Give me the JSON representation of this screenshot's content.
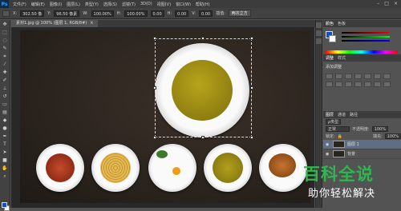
{
  "app": {
    "logo": "Ps"
  },
  "menu": [
    "文件(F)",
    "编辑(E)",
    "图像(I)",
    "图层(L)",
    "类型(Y)",
    "选择(S)",
    "滤镜(T)",
    "3D(D)",
    "视图(V)",
    "窗口(W)",
    "帮助(H)"
  ],
  "options": {
    "x_label": "X:",
    "x_value": "302.50 像",
    "y_label": "Y:",
    "y_value": "96.50 像素",
    "w_label": "W:",
    "w_value": "100.00%",
    "h_label": "H:",
    "h_value": "100.00%",
    "angle_value": "0.00",
    "h2_label": "H:",
    "h2_value": "0.00",
    "v_label": "V:",
    "v_value": "0.00",
    "interp_label": "插值:",
    "interp_value": "两次立方"
  },
  "document_tab": {
    "title": "素材1.jpg @ 100% (图层 1, RGB/8#)",
    "close": "×"
  },
  "panels": {
    "color_tabs": [
      "颜色",
      "色板"
    ],
    "adjust_tabs": [
      "调整",
      "样式"
    ],
    "adjust_title": "添加调整",
    "layers_tabs": [
      "图层",
      "通道",
      "路径"
    ],
    "kind_label": "ρ类型",
    "blend_mode": "正常",
    "opacity_label": "不透明度:",
    "opacity_value": "100%",
    "lock_label": "锁定:",
    "fill_label": "填充:",
    "fill_value": "100%",
    "layers": [
      {
        "name": "图层 1",
        "selected": true
      },
      {
        "name": "背景",
        "selected": false
      }
    ]
  },
  "watermark": {
    "title": "百科全说",
    "subtitle": "助你轻松解决"
  },
  "colors": {
    "accent": "#31a8ff",
    "watermark_green": "#2db84d",
    "fg_color": "#0a4fd8",
    "bg_color": "#ffffff"
  }
}
